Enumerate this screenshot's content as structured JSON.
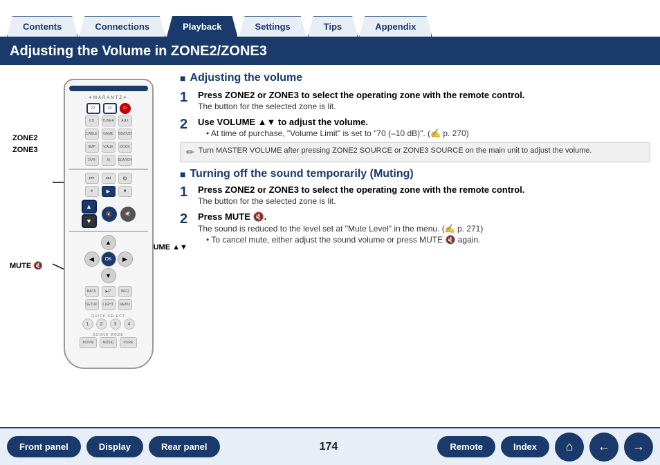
{
  "nav": {
    "tabs": [
      {
        "label": "Contents",
        "active": false
      },
      {
        "label": "Connections",
        "active": false
      },
      {
        "label": "Playback",
        "active": true
      },
      {
        "label": "Settings",
        "active": false
      },
      {
        "label": "Tips",
        "active": false
      },
      {
        "label": "Appendix",
        "active": false
      }
    ]
  },
  "page_title": "Adjusting the Volume in ZONE2/ZONE3",
  "sections": {
    "adjusting": {
      "heading": "Adjusting the volume",
      "steps": [
        {
          "num": "1",
          "main": "Press ZONE2 or ZONE3 to select the operating zone with the remote control.",
          "sub": "The button for the selected zone is lit."
        },
        {
          "num": "2",
          "main": "Use VOLUME ▲▼ to adjust the volume.",
          "bullets": [
            "At time of purchase, \"Volume Limit\" is set to \"70 (–10 dB)\". (✍ p. 270)"
          ]
        }
      ],
      "note": "Turn MASTER VOLUME after pressing ZONE2 SOURCE or ZONE3 SOURCE on the main unit to adjust the volume."
    },
    "muting": {
      "heading": "Turning off the sound temporarily (Muting)",
      "steps": [
        {
          "num": "1",
          "main": "Press ZONE2 or ZONE3 to select the operating zone with the remote control.",
          "sub": "The button for the selected zone is lit."
        },
        {
          "num": "2",
          "main": "Press MUTE 🔇.",
          "sub": "The sound is reduced to the level set at \"Mute Level\" in the menu. (✍ p. 271)",
          "bullets": [
            "To cancel mute, either adjust the sound volume or press MUTE 🔇 again."
          ]
        }
      ]
    }
  },
  "labels": {
    "zone2": "ZONE2",
    "zone3": "ZONE3",
    "volume": "VOLUME ▲▼",
    "mute": "MUTE 🔇"
  },
  "bottom": {
    "page_number": "174",
    "buttons": [
      {
        "label": "Front panel",
        "name": "front-panel-btn"
      },
      {
        "label": "Display",
        "name": "display-btn"
      },
      {
        "label": "Rear panel",
        "name": "rear-panel-btn"
      },
      {
        "label": "Remote",
        "name": "remote-btn"
      },
      {
        "label": "Index",
        "name": "index-btn"
      }
    ],
    "icons": [
      "home-icon",
      "back-icon",
      "forward-icon"
    ]
  }
}
